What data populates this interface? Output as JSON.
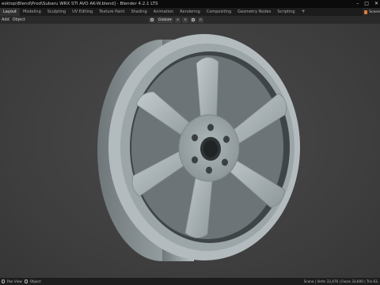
{
  "window": {
    "title": "esktop\\Blend\\Prod\\Subaru WRX STI AVO AK-W.blend] - Blender 4.2.1 LTS",
    "buttons": [
      "–",
      "□",
      "✕"
    ]
  },
  "tabs": [
    {
      "label": "Layout",
      "active": true
    },
    {
      "label": "Modeling"
    },
    {
      "label": "Sculpting"
    },
    {
      "label": "UV Editing"
    },
    {
      "label": "Texture Paint"
    },
    {
      "label": "Shading"
    },
    {
      "label": "Animation"
    },
    {
      "label": "Rendering"
    },
    {
      "label": "Compositing"
    },
    {
      "label": "Geometry Nodes"
    },
    {
      "label": "Scripting"
    }
  ],
  "tab_add": "+",
  "scene": {
    "label": "Scene",
    "icon": "scene-icon"
  },
  "header": {
    "menus": [
      "Add",
      "Object"
    ],
    "orientation": "Global"
  },
  "status": {
    "left_items": [
      "Pan View",
      "Object"
    ],
    "right_text": "Scene | Verts 33,476 | Faces 33,600 | Tris 63,"
  }
}
